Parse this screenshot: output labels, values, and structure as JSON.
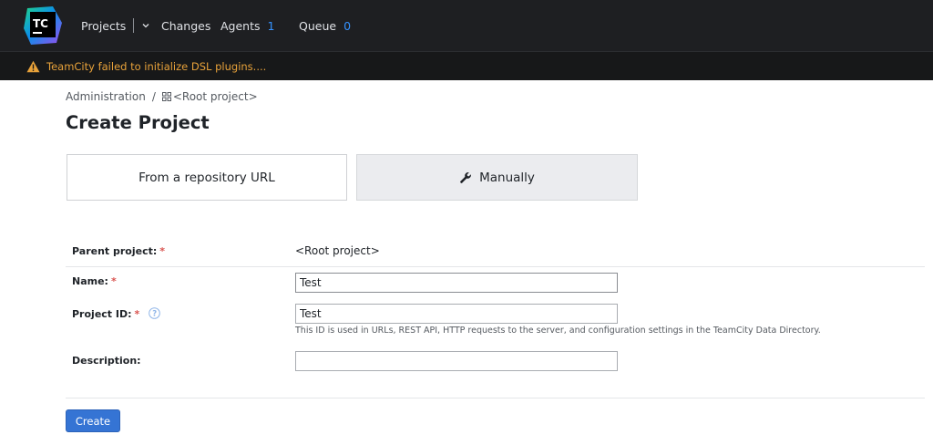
{
  "header": {
    "logo_text": "TC",
    "nav": {
      "projects": "Projects",
      "changes": "Changes",
      "agents": "Agents",
      "agents_count": "1",
      "queue": "Queue",
      "queue_count": "0"
    },
    "warning": "TeamCity failed to initialize DSL plugins...."
  },
  "breadcrumb": {
    "admin": "Administration",
    "separator": "/",
    "project": "<Root project>"
  },
  "page_title": "Create Project",
  "options": {
    "repo": "From a repository URL",
    "manual": "Manually"
  },
  "form": {
    "parent_label": "Parent project:",
    "parent_value": "<Root project>",
    "name_label": "Name:",
    "name_value": "Test",
    "id_label": "Project ID:",
    "id_value": "Test",
    "id_hint": "This ID is used in URLs, REST API, HTTP requests to the server, and configuration settings in the TeamCity Data Directory.",
    "description_label": "Description:",
    "description_value": "",
    "required_mark": "*"
  },
  "create_label": "Create",
  "colors": {
    "header_bg": "#1e1f22",
    "warning": "#e8a23a",
    "accent": "#3574d4",
    "count": "#3592ff"
  }
}
